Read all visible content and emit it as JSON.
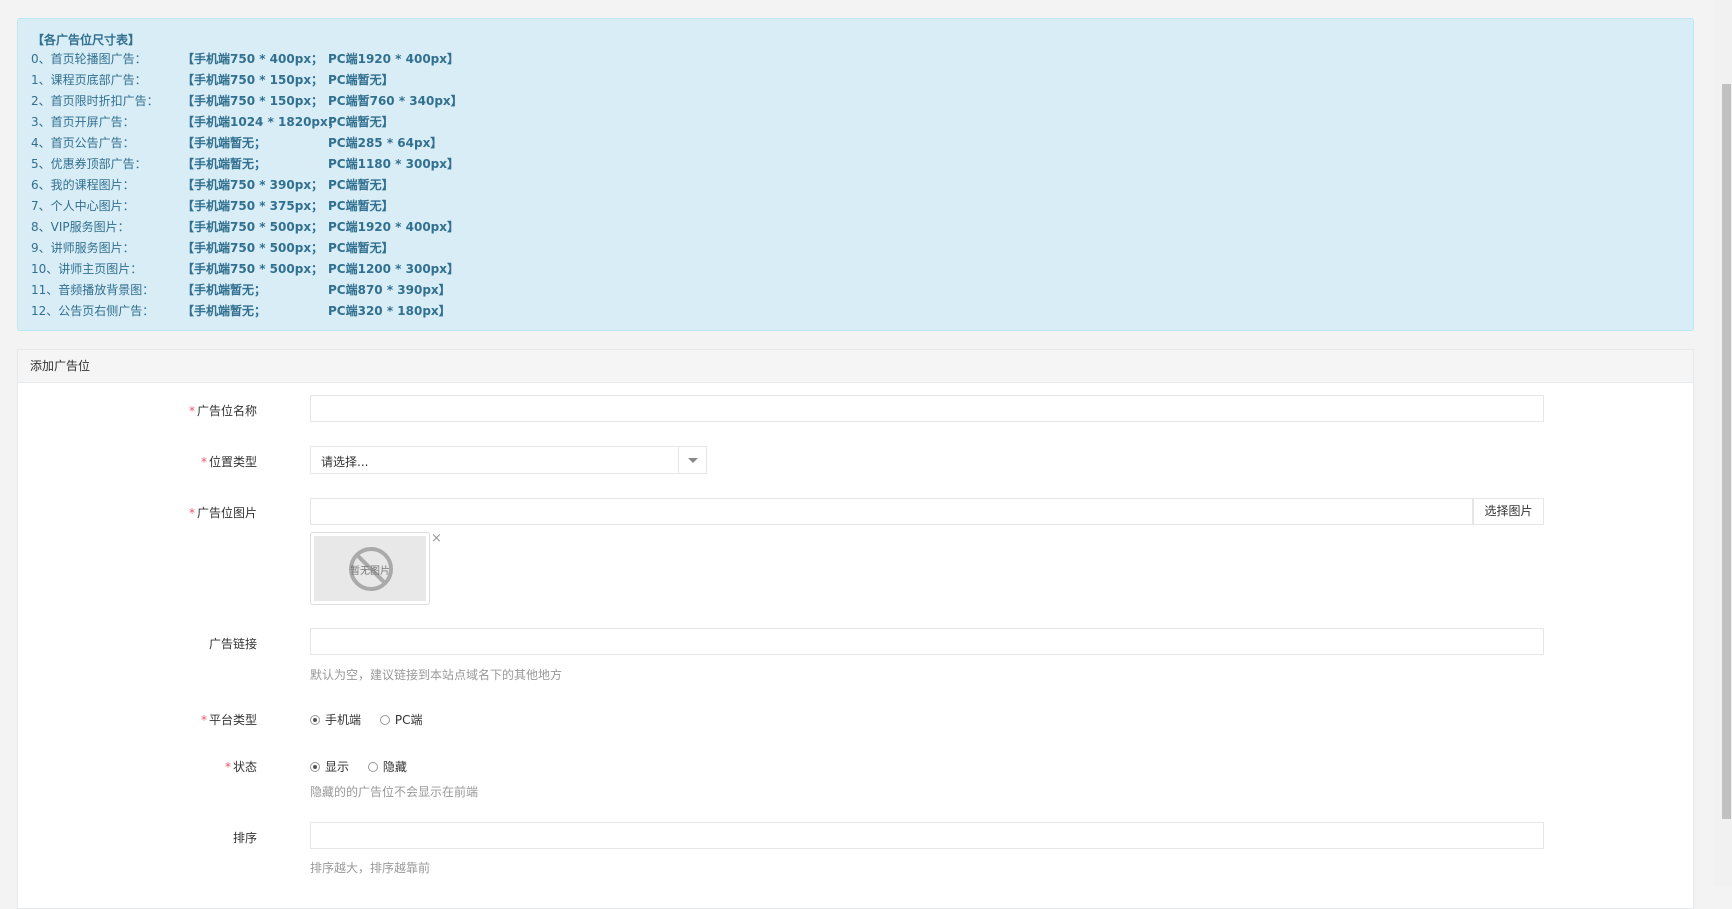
{
  "info": {
    "title": "【各广告位尺寸表】",
    "rows": [
      {
        "label": "0、首页轮播图广告：",
        "mobile": "【手机端750 * 400px；",
        "pc": "PC端1920 * 400px】"
      },
      {
        "label": "1、课程页底部广告：",
        "mobile": "【手机端750 * 150px；",
        "pc": "PC端暂无】"
      },
      {
        "label": "2、首页限时折扣广告：",
        "mobile": "【手机端750 * 150px；",
        "pc": "PC端暂760 * 340px】"
      },
      {
        "label": "3、首页开屏广告：",
        "mobile": "【手机端1024 * 1820px；",
        "pc": "PC端暂无】"
      },
      {
        "label": "4、首页公告广告：",
        "mobile": "【手机端暂无；",
        "pc": "PC端285 * 64px】"
      },
      {
        "label": "5、优惠券顶部广告：",
        "mobile": "【手机端暂无；",
        "pc": "PC端1180 * 300px】"
      },
      {
        "label": "6、我的课程图片：",
        "mobile": "【手机端750 * 390px；",
        "pc": "PC端暂无】"
      },
      {
        "label": "7、个人中心图片：",
        "mobile": "【手机端750 * 375px；",
        "pc": "PC端暂无】"
      },
      {
        "label": "8、VIP服务图片：",
        "mobile": "【手机端750 * 500px；",
        "pc": "PC端1920 * 400px】"
      },
      {
        "label": "9、讲师服务图片：",
        "mobile": "【手机端750 * 500px；",
        "pc": "PC端暂无】"
      },
      {
        "label": "10、讲师主页图片：",
        "mobile": "【手机端750 * 500px；",
        "pc": "PC端1200 * 300px】"
      },
      {
        "label": "11、音频播放背景图：",
        "mobile": "【手机端暂无；",
        "pc": "PC端870 * 390px】"
      },
      {
        "label": "12、公告页右侧广告：",
        "mobile": "【手机端暂无；",
        "pc": "PC端320 * 180px】"
      }
    ]
  },
  "panel": {
    "heading": "添加广告位"
  },
  "form": {
    "name": {
      "required": "*",
      "label": "广告位名称",
      "value": ""
    },
    "position_type": {
      "required": "*",
      "label": "位置类型",
      "selected": "请选择..."
    },
    "image": {
      "required": "*",
      "label": "广告位图片",
      "value": "",
      "choose_label": "选择图片",
      "placeholder_text": "暂无图片",
      "remove_glyph": "×"
    },
    "link": {
      "label": "广告链接",
      "value": "",
      "help": "默认为空，建议链接到本站点域名下的其他地方"
    },
    "platform": {
      "required": "*",
      "label": "平台类型",
      "options": [
        {
          "label": "手机端",
          "checked": true
        },
        {
          "label": "PC端",
          "checked": false
        }
      ]
    },
    "status": {
      "required": "*",
      "label": "状态",
      "options": [
        {
          "label": "显示",
          "checked": true
        },
        {
          "label": "隐藏",
          "checked": false
        }
      ],
      "help": "隐藏的的广告位不会显示在前端"
    },
    "sort": {
      "label": "排序",
      "value": "",
      "help": "排序越大，排序越靠前"
    }
  }
}
